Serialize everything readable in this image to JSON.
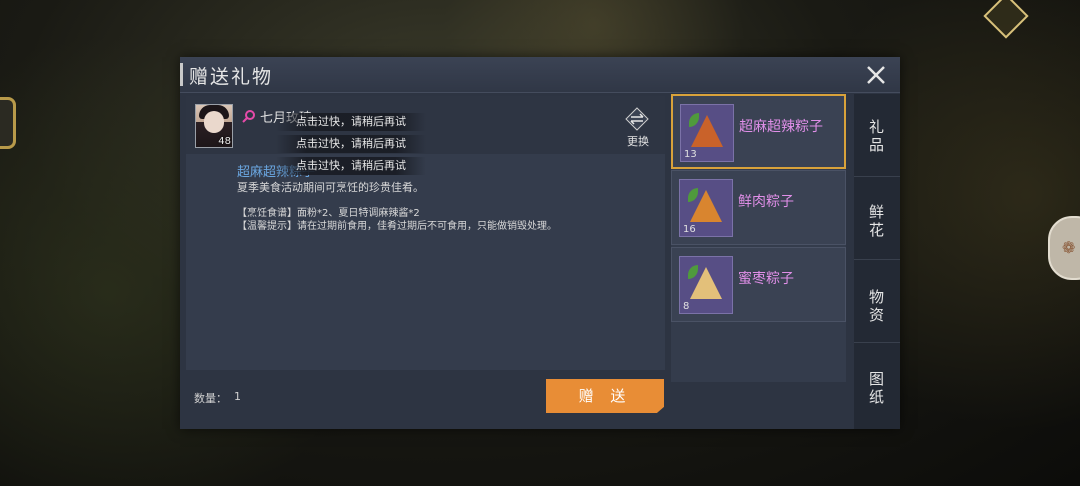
{
  "dialog": {
    "title": "赠送礼物",
    "recipient": {
      "name": "七月玫瑰",
      "level": "48"
    },
    "change_label": "更换",
    "selected_item": {
      "name": "超麻超辣粽子",
      "description": "夏季美食活动期间可烹饪的珍贵佳肴。",
      "recipe": "【烹饪食谱】面粉*2、夏日特调麻辣酱*2",
      "tip": "【温馨提示】请在过期前食用，佳肴过期后不可食用，只能做销毁处理。"
    },
    "toasts": [
      "点击过快，请稍后再试",
      "点击过快，请稍后再试",
      "点击过快，请稍后再试"
    ],
    "quantity_label": "数量：",
    "quantity_value": "1",
    "send_label": "赠 送"
  },
  "items": [
    {
      "name": "超麻超辣粽子",
      "count": "13",
      "selected": true
    },
    {
      "name": "鲜肉粽子",
      "count": "16",
      "selected": false
    },
    {
      "name": "蜜枣粽子",
      "count": "8",
      "selected": false
    }
  ],
  "tabs": [
    {
      "line1": "礼",
      "line2": "品"
    },
    {
      "line1": "鲜",
      "line2": "花"
    },
    {
      "line1": "物",
      "line2": "资"
    },
    {
      "line1": "图",
      "line2": "纸"
    }
  ],
  "colors": {
    "accent_orange": "#e88d36",
    "selected_border": "#d9a23a",
    "item_name_blue": "#6aa6e0",
    "item_label_pink": "#e08fe8",
    "gender_icon_pink": "#e54aa8"
  }
}
